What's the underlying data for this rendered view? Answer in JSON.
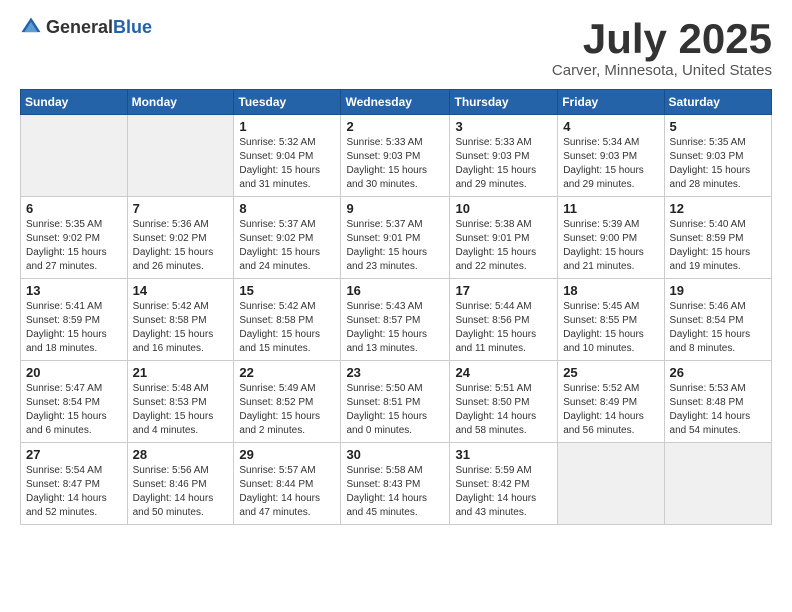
{
  "logo": {
    "general": "General",
    "blue": "Blue"
  },
  "title": {
    "month": "July 2025",
    "location": "Carver, Minnesota, United States"
  },
  "header_days": [
    "Sunday",
    "Monday",
    "Tuesday",
    "Wednesday",
    "Thursday",
    "Friday",
    "Saturday"
  ],
  "weeks": [
    [
      {
        "day": "",
        "empty": true
      },
      {
        "day": "",
        "empty": true
      },
      {
        "day": "1",
        "sunrise": "Sunrise: 5:32 AM",
        "sunset": "Sunset: 9:04 PM",
        "daylight": "Daylight: 15 hours and 31 minutes."
      },
      {
        "day": "2",
        "sunrise": "Sunrise: 5:33 AM",
        "sunset": "Sunset: 9:03 PM",
        "daylight": "Daylight: 15 hours and 30 minutes."
      },
      {
        "day": "3",
        "sunrise": "Sunrise: 5:33 AM",
        "sunset": "Sunset: 9:03 PM",
        "daylight": "Daylight: 15 hours and 29 minutes."
      },
      {
        "day": "4",
        "sunrise": "Sunrise: 5:34 AM",
        "sunset": "Sunset: 9:03 PM",
        "daylight": "Daylight: 15 hours and 29 minutes."
      },
      {
        "day": "5",
        "sunrise": "Sunrise: 5:35 AM",
        "sunset": "Sunset: 9:03 PM",
        "daylight": "Daylight: 15 hours and 28 minutes."
      }
    ],
    [
      {
        "day": "6",
        "sunrise": "Sunrise: 5:35 AM",
        "sunset": "Sunset: 9:02 PM",
        "daylight": "Daylight: 15 hours and 27 minutes."
      },
      {
        "day": "7",
        "sunrise": "Sunrise: 5:36 AM",
        "sunset": "Sunset: 9:02 PM",
        "daylight": "Daylight: 15 hours and 26 minutes."
      },
      {
        "day": "8",
        "sunrise": "Sunrise: 5:37 AM",
        "sunset": "Sunset: 9:02 PM",
        "daylight": "Daylight: 15 hours and 24 minutes."
      },
      {
        "day": "9",
        "sunrise": "Sunrise: 5:37 AM",
        "sunset": "Sunset: 9:01 PM",
        "daylight": "Daylight: 15 hours and 23 minutes."
      },
      {
        "day": "10",
        "sunrise": "Sunrise: 5:38 AM",
        "sunset": "Sunset: 9:01 PM",
        "daylight": "Daylight: 15 hours and 22 minutes."
      },
      {
        "day": "11",
        "sunrise": "Sunrise: 5:39 AM",
        "sunset": "Sunset: 9:00 PM",
        "daylight": "Daylight: 15 hours and 21 minutes."
      },
      {
        "day": "12",
        "sunrise": "Sunrise: 5:40 AM",
        "sunset": "Sunset: 8:59 PM",
        "daylight": "Daylight: 15 hours and 19 minutes."
      }
    ],
    [
      {
        "day": "13",
        "sunrise": "Sunrise: 5:41 AM",
        "sunset": "Sunset: 8:59 PM",
        "daylight": "Daylight: 15 hours and 18 minutes."
      },
      {
        "day": "14",
        "sunrise": "Sunrise: 5:42 AM",
        "sunset": "Sunset: 8:58 PM",
        "daylight": "Daylight: 15 hours and 16 minutes."
      },
      {
        "day": "15",
        "sunrise": "Sunrise: 5:42 AM",
        "sunset": "Sunset: 8:58 PM",
        "daylight": "Daylight: 15 hours and 15 minutes."
      },
      {
        "day": "16",
        "sunrise": "Sunrise: 5:43 AM",
        "sunset": "Sunset: 8:57 PM",
        "daylight": "Daylight: 15 hours and 13 minutes."
      },
      {
        "day": "17",
        "sunrise": "Sunrise: 5:44 AM",
        "sunset": "Sunset: 8:56 PM",
        "daylight": "Daylight: 15 hours and 11 minutes."
      },
      {
        "day": "18",
        "sunrise": "Sunrise: 5:45 AM",
        "sunset": "Sunset: 8:55 PM",
        "daylight": "Daylight: 15 hours and 10 minutes."
      },
      {
        "day": "19",
        "sunrise": "Sunrise: 5:46 AM",
        "sunset": "Sunset: 8:54 PM",
        "daylight": "Daylight: 15 hours and 8 minutes."
      }
    ],
    [
      {
        "day": "20",
        "sunrise": "Sunrise: 5:47 AM",
        "sunset": "Sunset: 8:54 PM",
        "daylight": "Daylight: 15 hours and 6 minutes."
      },
      {
        "day": "21",
        "sunrise": "Sunrise: 5:48 AM",
        "sunset": "Sunset: 8:53 PM",
        "daylight": "Daylight: 15 hours and 4 minutes."
      },
      {
        "day": "22",
        "sunrise": "Sunrise: 5:49 AM",
        "sunset": "Sunset: 8:52 PM",
        "daylight": "Daylight: 15 hours and 2 minutes."
      },
      {
        "day": "23",
        "sunrise": "Sunrise: 5:50 AM",
        "sunset": "Sunset: 8:51 PM",
        "daylight": "Daylight: 15 hours and 0 minutes."
      },
      {
        "day": "24",
        "sunrise": "Sunrise: 5:51 AM",
        "sunset": "Sunset: 8:50 PM",
        "daylight": "Daylight: 14 hours and 58 minutes."
      },
      {
        "day": "25",
        "sunrise": "Sunrise: 5:52 AM",
        "sunset": "Sunset: 8:49 PM",
        "daylight": "Daylight: 14 hours and 56 minutes."
      },
      {
        "day": "26",
        "sunrise": "Sunrise: 5:53 AM",
        "sunset": "Sunset: 8:48 PM",
        "daylight": "Daylight: 14 hours and 54 minutes."
      }
    ],
    [
      {
        "day": "27",
        "sunrise": "Sunrise: 5:54 AM",
        "sunset": "Sunset: 8:47 PM",
        "daylight": "Daylight: 14 hours and 52 minutes."
      },
      {
        "day": "28",
        "sunrise": "Sunrise: 5:56 AM",
        "sunset": "Sunset: 8:46 PM",
        "daylight": "Daylight: 14 hours and 50 minutes."
      },
      {
        "day": "29",
        "sunrise": "Sunrise: 5:57 AM",
        "sunset": "Sunset: 8:44 PM",
        "daylight": "Daylight: 14 hours and 47 minutes."
      },
      {
        "day": "30",
        "sunrise": "Sunrise: 5:58 AM",
        "sunset": "Sunset: 8:43 PM",
        "daylight": "Daylight: 14 hours and 45 minutes."
      },
      {
        "day": "31",
        "sunrise": "Sunrise: 5:59 AM",
        "sunset": "Sunset: 8:42 PM",
        "daylight": "Daylight: 14 hours and 43 minutes."
      },
      {
        "day": "",
        "empty": true
      },
      {
        "day": "",
        "empty": true
      }
    ]
  ]
}
